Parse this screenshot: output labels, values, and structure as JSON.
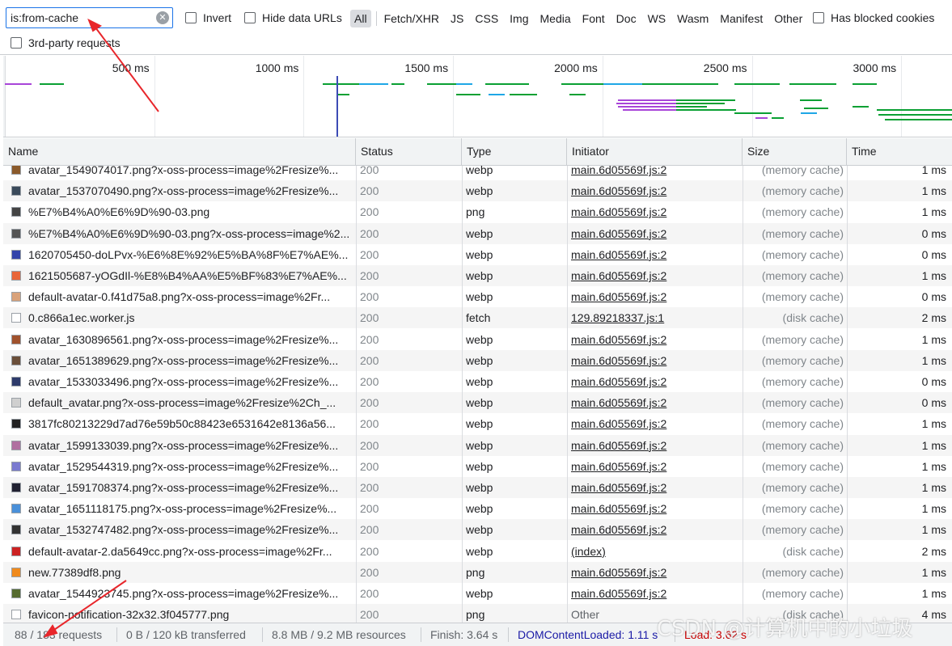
{
  "filter_bar": {
    "filter_value": "is:from-cache",
    "invert_label": "Invert",
    "hide_data_urls_label": "Hide data URLs",
    "type_filters": [
      "All",
      "Fetch/XHR",
      "JS",
      "CSS",
      "Img",
      "Media",
      "Font",
      "Doc",
      "WS",
      "Wasm",
      "Manifest",
      "Other"
    ],
    "active_type_filter": "All",
    "blocked_cookies_label": "Has blocked cookies",
    "third_party_label": "3rd-party requests"
  },
  "overview": {
    "ticks": [
      "500 ms",
      "1000 ms",
      "1500 ms",
      "2000 ms",
      "2500 ms",
      "3000 ms"
    ],
    "colors": {
      "script": "#0aa033",
      "xhr": "#a845d8",
      "image": "#1ea7e6",
      "doc": "#3c4bb5",
      "grid": "#e8eaed"
    }
  },
  "table": {
    "columns": [
      "Name",
      "Status",
      "Type",
      "Initiator",
      "Size",
      "Time"
    ],
    "rows": [
      {
        "name": "avatar_1549074017.png?x-oss-process=image%2Fresize%...",
        "status": "200",
        "type": "webp",
        "initiator": "main.6d05569f.js:2",
        "size": "(memory cache)",
        "time": "1 ms",
        "icon": "image-thumb-icon"
      },
      {
        "name": "avatar_1537070490.png?x-oss-process=image%2Fresize%...",
        "status": "200",
        "type": "webp",
        "initiator": "main.6d05569f.js:2",
        "size": "(memory cache)",
        "time": "1 ms",
        "icon": "image-thumb-icon"
      },
      {
        "name": "%E7%B4%A0%E6%9D%90-03.png",
        "status": "200",
        "type": "png",
        "initiator": "main.6d05569f.js:2",
        "size": "(memory cache)",
        "time": "1 ms",
        "icon": "image-thumb-icon"
      },
      {
        "name": "%E7%B4%A0%E6%9D%90-03.png?x-oss-process=image%2...",
        "status": "200",
        "type": "webp",
        "initiator": "main.6d05569f.js:2",
        "size": "(memory cache)",
        "time": "0 ms",
        "icon": "image-thumb-icon"
      },
      {
        "name": "1620705450-doLPvx-%E6%8E%92%E5%BA%8F%E7%AE%...",
        "status": "200",
        "type": "webp",
        "initiator": "main.6d05569f.js:2",
        "size": "(memory cache)",
        "time": "0 ms",
        "icon": "image-thumb-icon"
      },
      {
        "name": "1621505687-yOGdIl-%E8%B4%AA%E5%BF%83%E7%AE%...",
        "status": "200",
        "type": "webp",
        "initiator": "main.6d05569f.js:2",
        "size": "(memory cache)",
        "time": "1 ms",
        "icon": "image-thumb-icon"
      },
      {
        "name": "default-avatar-0.f41d75a8.png?x-oss-process=image%2Fr...",
        "status": "200",
        "type": "webp",
        "initiator": "main.6d05569f.js:2",
        "size": "(memory cache)",
        "time": "0 ms",
        "icon": "image-thumb-icon"
      },
      {
        "name": "0.c866a1ec.worker.js",
        "status": "200",
        "type": "fetch",
        "initiator": "129.89218337.js:1",
        "size": "(disk cache)",
        "time": "2 ms",
        "icon": "file-icon"
      },
      {
        "name": "avatar_1630896561.png?x-oss-process=image%2Fresize%...",
        "status": "200",
        "type": "webp",
        "initiator": "main.6d05569f.js:2",
        "size": "(memory cache)",
        "time": "1 ms",
        "icon": "image-thumb-icon"
      },
      {
        "name": "avatar_1651389629.png?x-oss-process=image%2Fresize%...",
        "status": "200",
        "type": "webp",
        "initiator": "main.6d05569f.js:2",
        "size": "(memory cache)",
        "time": "1 ms",
        "icon": "image-thumb-icon"
      },
      {
        "name": "avatar_1533033496.png?x-oss-process=image%2Fresize%...",
        "status": "200",
        "type": "webp",
        "initiator": "main.6d05569f.js:2",
        "size": "(memory cache)",
        "time": "0 ms",
        "icon": "image-thumb-icon"
      },
      {
        "name": "default_avatar.png?x-oss-process=image%2Fresize%2Ch_...",
        "status": "200",
        "type": "webp",
        "initiator": "main.6d05569f.js:2",
        "size": "(memory cache)",
        "time": "0 ms",
        "icon": "image-thumb-icon"
      },
      {
        "name": "3817fc80213229d7ad76e59b50c88423e6531642e8136a56...",
        "status": "200",
        "type": "webp",
        "initiator": "main.6d05569f.js:2",
        "size": "(memory cache)",
        "time": "1 ms",
        "icon": "image-thumb-icon"
      },
      {
        "name": "avatar_1599133039.png?x-oss-process=image%2Fresize%...",
        "status": "200",
        "type": "webp",
        "initiator": "main.6d05569f.js:2",
        "size": "(memory cache)",
        "time": "1 ms",
        "icon": "image-thumb-icon"
      },
      {
        "name": "avatar_1529544319.png?x-oss-process=image%2Fresize%...",
        "status": "200",
        "type": "webp",
        "initiator": "main.6d05569f.js:2",
        "size": "(memory cache)",
        "time": "1 ms",
        "icon": "image-thumb-icon"
      },
      {
        "name": "avatar_1591708374.png?x-oss-process=image%2Fresize%...",
        "status": "200",
        "type": "webp",
        "initiator": "main.6d05569f.js:2",
        "size": "(memory cache)",
        "time": "1 ms",
        "icon": "image-thumb-icon"
      },
      {
        "name": "avatar_1651118175.png?x-oss-process=image%2Fresize%...",
        "status": "200",
        "type": "webp",
        "initiator": "main.6d05569f.js:2",
        "size": "(memory cache)",
        "time": "1 ms",
        "icon": "image-thumb-icon"
      },
      {
        "name": "avatar_1532747482.png?x-oss-process=image%2Fresize%...",
        "status": "200",
        "type": "webp",
        "initiator": "main.6d05569f.js:2",
        "size": "(memory cache)",
        "time": "1 ms",
        "icon": "image-thumb-icon"
      },
      {
        "name": "default-avatar-2.da5649cc.png?x-oss-process=image%2Fr...",
        "status": "200",
        "type": "webp",
        "initiator": "(index)",
        "size": "(disk cache)",
        "time": "2 ms",
        "icon": "image-thumb-icon"
      },
      {
        "name": "new.77389df8.png",
        "status": "200",
        "type": "png",
        "initiator": "main.6d05569f.js:2",
        "size": "(memory cache)",
        "time": "1 ms",
        "icon": "image-thumb-icon"
      },
      {
        "name": "avatar_1544923745.png?x-oss-process=image%2Fresize%...",
        "status": "200",
        "type": "webp",
        "initiator": "main.6d05569f.js:2",
        "size": "(memory cache)",
        "time": "1 ms",
        "icon": "image-thumb-icon"
      },
      {
        "name": "favicon-notification-32x32.3f045777.png",
        "status": "200",
        "type": "png",
        "initiator": "Other",
        "size": "(disk cache)",
        "time": "4 ms",
        "icon": "file-icon"
      }
    ]
  },
  "status_bar": {
    "requests": "88 / 183 requests",
    "transferred": "0 B / 120 kB transferred",
    "resources": "8.8 MB / 9.2 MB resources",
    "finish": "Finish: 3.64 s",
    "dom_content_loaded": "DOMContentLoaded: 1.11 s",
    "load": "Load: 3.62 s"
  },
  "watermark": "CSDN @计算机中的小垃圾",
  "annotation_color": "#e8262b"
}
